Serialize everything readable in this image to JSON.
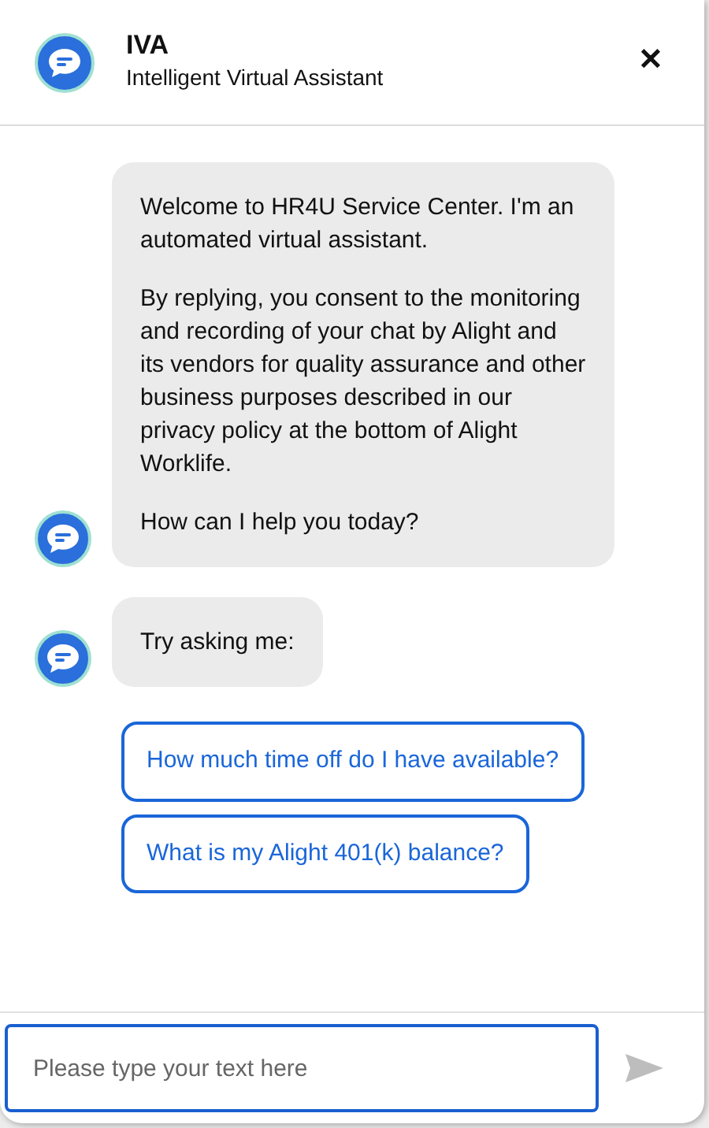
{
  "header": {
    "title": "IVA",
    "subtitle": "Intelligent Virtual Assistant",
    "close": "✕"
  },
  "messages": [
    {
      "paragraphs": [
        "Welcome to HR4U Service Center. I'm an automated virtual assistant.",
        "By replying, you consent to the monitoring and recording of your chat by Alight and its vendors for quality assurance and other business purposes described in our privacy policy at the bottom of Alight Worklife.",
        "How can I help you today?"
      ]
    },
    {
      "paragraphs": [
        "Try asking me:"
      ]
    }
  ],
  "suggestions": [
    "How much time off do I have available?",
    "What is my Alight 401(k) balance?"
  ],
  "composer": {
    "placeholder": "Please type your text here",
    "send_disabled": true
  }
}
